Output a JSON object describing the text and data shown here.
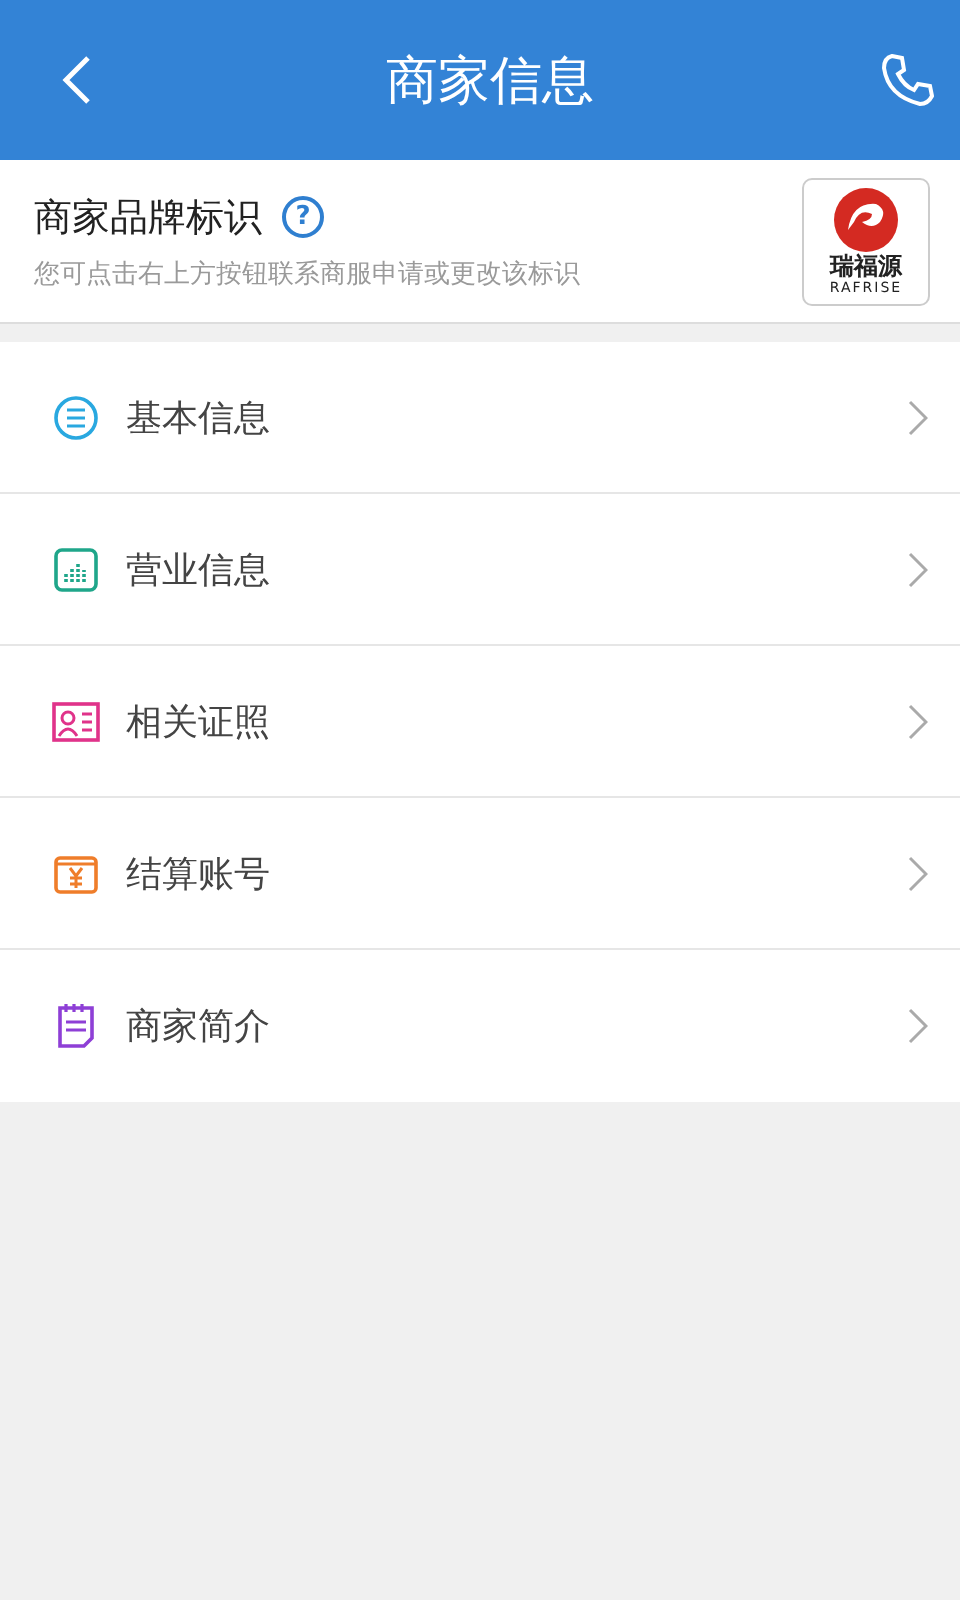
{
  "header": {
    "title": "商家信息"
  },
  "brand": {
    "title": "商家品牌标识",
    "help": "?",
    "hint": "您可点击右上方按钮联系商服申请或更改该标识",
    "logo_name": "瑞福源",
    "logo_latin": "RAFRISE"
  },
  "menu": [
    {
      "label": "基本信息",
      "kind": "list",
      "color": "#29a8e0"
    },
    {
      "label": "营业信息",
      "kind": "chart",
      "color": "#1fa68a"
    },
    {
      "label": "相关证照",
      "kind": "card",
      "color": "#e0338a"
    },
    {
      "label": "结算账号",
      "kind": "money",
      "color": "#ef7d2a"
    },
    {
      "label": "商家简介",
      "kind": "note",
      "color": "#8e3fd6"
    }
  ]
}
